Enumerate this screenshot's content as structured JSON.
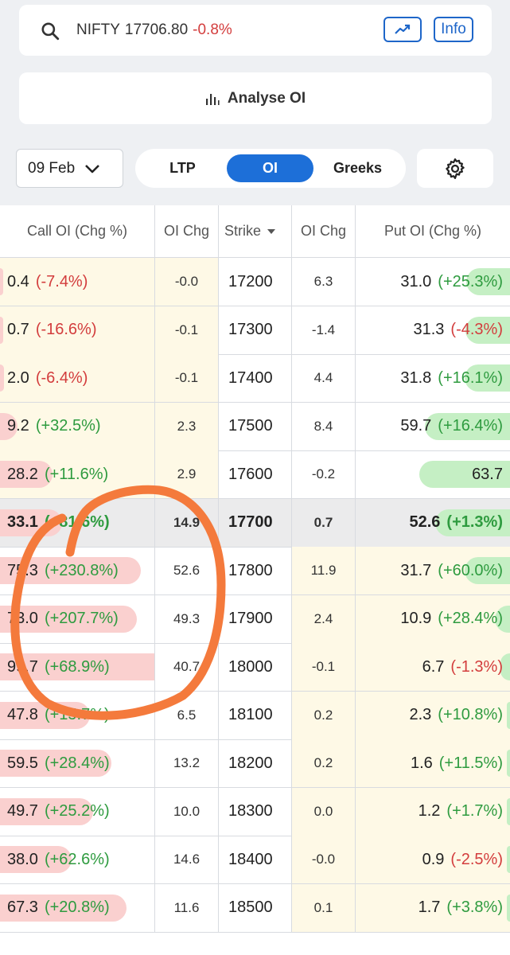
{
  "header": {
    "symbol": "NIFTY",
    "price": "17706.80",
    "change": "-0.8%",
    "info_label": "Info",
    "search_icon": "search-icon",
    "chart_icon": "trending-up-icon"
  },
  "analyse": {
    "label": "Analyse OI",
    "icon": "bar-chart-icon"
  },
  "controls": {
    "expiry": "09 Feb",
    "tabs": [
      "LTP",
      "OI",
      "Greeks"
    ],
    "active_tab": "OI",
    "settings_icon": "gear-icon"
  },
  "table": {
    "headers": [
      "Call OI (Chg %)",
      "OI Chg",
      "Strike",
      "OI Chg",
      "Put OI (Chg %)"
    ],
    "rows": [
      {
        "call_oi": "0.4",
        "call_chg": "(-7.4%)",
        "call_oi_chg": "-0.0",
        "strike": "17200",
        "put_oi_chg": "6.3",
        "put_oi": "31.0",
        "put_chg": "(+25.3%)"
      },
      {
        "call_oi": "0.7",
        "call_chg": "(-16.6%)",
        "call_oi_chg": "-0.1",
        "strike": "17300",
        "put_oi_chg": "-1.4",
        "put_oi": "31.3",
        "put_chg": "(-4.3%)"
      },
      {
        "call_oi": "2.0",
        "call_chg": "(-6.4%)",
        "call_oi_chg": "-0.1",
        "strike": "17400",
        "put_oi_chg": "4.4",
        "put_oi": "31.8",
        "put_chg": "(+16.1%)"
      },
      {
        "call_oi": "9.2",
        "call_chg": "(+32.5%)",
        "call_oi_chg": "2.3",
        "strike": "17500",
        "put_oi_chg": "8.4",
        "put_oi": "59.7",
        "put_chg": "(+16.4%)"
      },
      {
        "call_oi": "28.2",
        "call_chg": "(+11.6%)",
        "call_oi_chg": "2.9",
        "strike": "17600",
        "put_oi_chg": "-0.2",
        "put_oi": "63.7",
        "put_chg": ""
      },
      {
        "call_oi": "33.1",
        "call_chg": "(+81.6%)",
        "call_oi_chg": "14.9",
        "strike": "17700",
        "put_oi_chg": "0.7",
        "put_oi": "52.6",
        "put_chg": "(+1.3%)"
      },
      {
        "call_oi": "75.3",
        "call_chg": "(+230.8%)",
        "call_oi_chg": "52.6",
        "strike": "17800",
        "put_oi_chg": "11.9",
        "put_oi": "31.7",
        "put_chg": "(+60.0%)"
      },
      {
        "call_oi": "73.0",
        "call_chg": "(+207.7%)",
        "call_oi_chg": "49.3",
        "strike": "17900",
        "put_oi_chg": "2.4",
        "put_oi": "10.9",
        "put_chg": "(+28.4%)"
      },
      {
        "call_oi": "99.7",
        "call_chg": "(+68.9%)",
        "call_oi_chg": "40.7",
        "strike": "18000",
        "put_oi_chg": "-0.1",
        "put_oi": "6.7",
        "put_chg": "(-1.3%)"
      },
      {
        "call_oi": "47.8",
        "call_chg": "(+15.7%)",
        "call_oi_chg": "6.5",
        "strike": "18100",
        "put_oi_chg": "0.2",
        "put_oi": "2.3",
        "put_chg": "(+10.8%)"
      },
      {
        "call_oi": "59.5",
        "call_chg": "(+28.4%)",
        "call_oi_chg": "13.2",
        "strike": "18200",
        "put_oi_chg": "0.2",
        "put_oi": "1.6",
        "put_chg": "(+11.5%)"
      },
      {
        "call_oi": "49.7",
        "call_chg": "(+25.2%)",
        "call_oi_chg": "10.0",
        "strike": "18300",
        "put_oi_chg": "0.0",
        "put_oi": "1.2",
        "put_chg": "(+1.7%)"
      },
      {
        "call_oi": "38.0",
        "call_chg": "(+62.6%)",
        "call_oi_chg": "14.6",
        "strike": "18400",
        "put_oi_chg": "-0.0",
        "put_oi": "0.9",
        "put_chg": "(-2.5%)"
      },
      {
        "call_oi": "67.3",
        "call_chg": "(+20.8%)",
        "call_oi_chg": "11.6",
        "strike": "18500",
        "put_oi_chg": "0.1",
        "put_oi": "1.7",
        "put_chg": "(+3.8%)"
      }
    ]
  },
  "colors": {
    "accent": "#1d6fd8",
    "negative": "#d33d3d",
    "positive": "#2e9b3f",
    "call_bar": "#fad0cf",
    "put_bar": "#c5efc4",
    "itm_background": "#fef9e6",
    "annotation": "#f47a3c"
  }
}
